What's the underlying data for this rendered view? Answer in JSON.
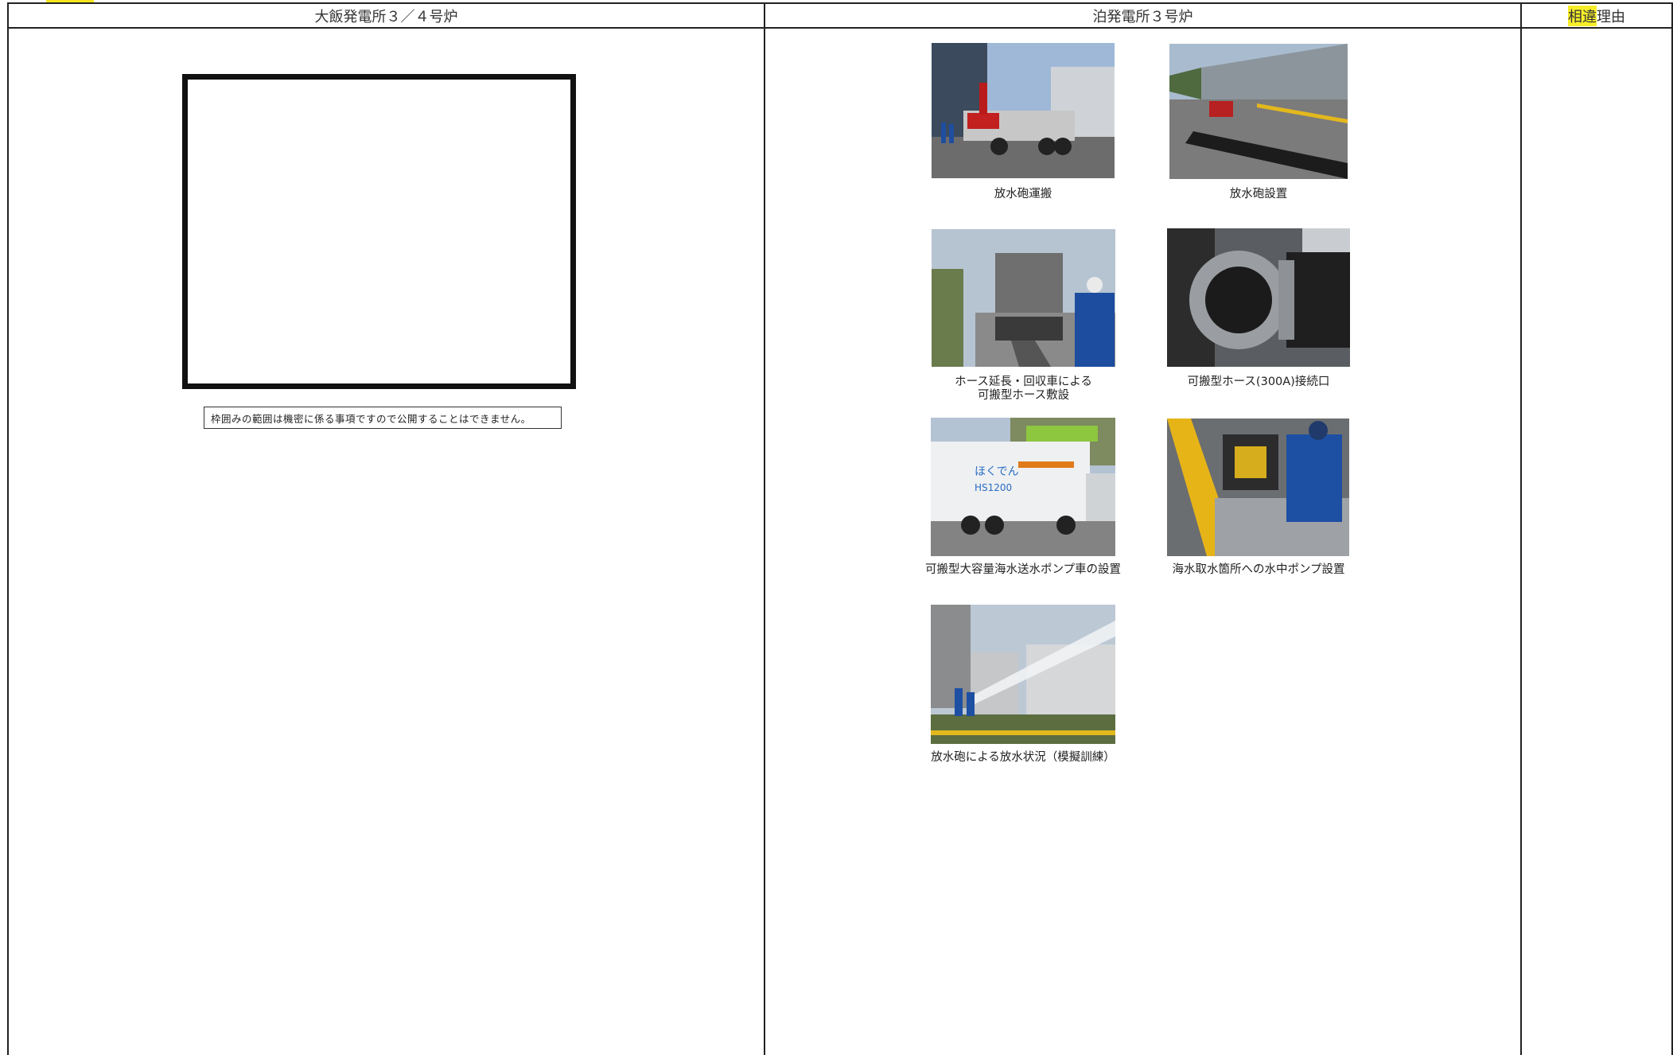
{
  "header": {
    "col_left": "大飯発電所３／４号炉",
    "col_mid": "泊発電所３号炉",
    "col_right_highlight": "相違",
    "col_right_rest": "理由"
  },
  "left": {
    "confidential_note": "枠囲みの範囲は機密に係る事項ですので公開することはできません。"
  },
  "photos": [
    {
      "caption_lines": [
        "放水砲運搬"
      ]
    },
    {
      "caption_lines": [
        "放水砲設置"
      ]
    },
    {
      "caption_lines": [
        "ホース延長・回収車による",
        "可搬型ホース敷設"
      ]
    },
    {
      "caption_lines": [
        "可搬型ホース(300A)接続口"
      ]
    },
    {
      "caption_lines": [
        "可搬型大容量海水送水ポンプ車の設置"
      ]
    },
    {
      "caption_lines": [
        "海水取水箇所への水中ポンプ設置"
      ]
    },
    {
      "caption_lines": [
        "放水砲による放水状況（模擬訓練）"
      ]
    }
  ],
  "photo_texts": {
    "truck_brand": "ほくでん",
    "truck_model": "HS1200"
  },
  "colors": {
    "highlight": "#f7ee2a",
    "rule": "#222222"
  }
}
